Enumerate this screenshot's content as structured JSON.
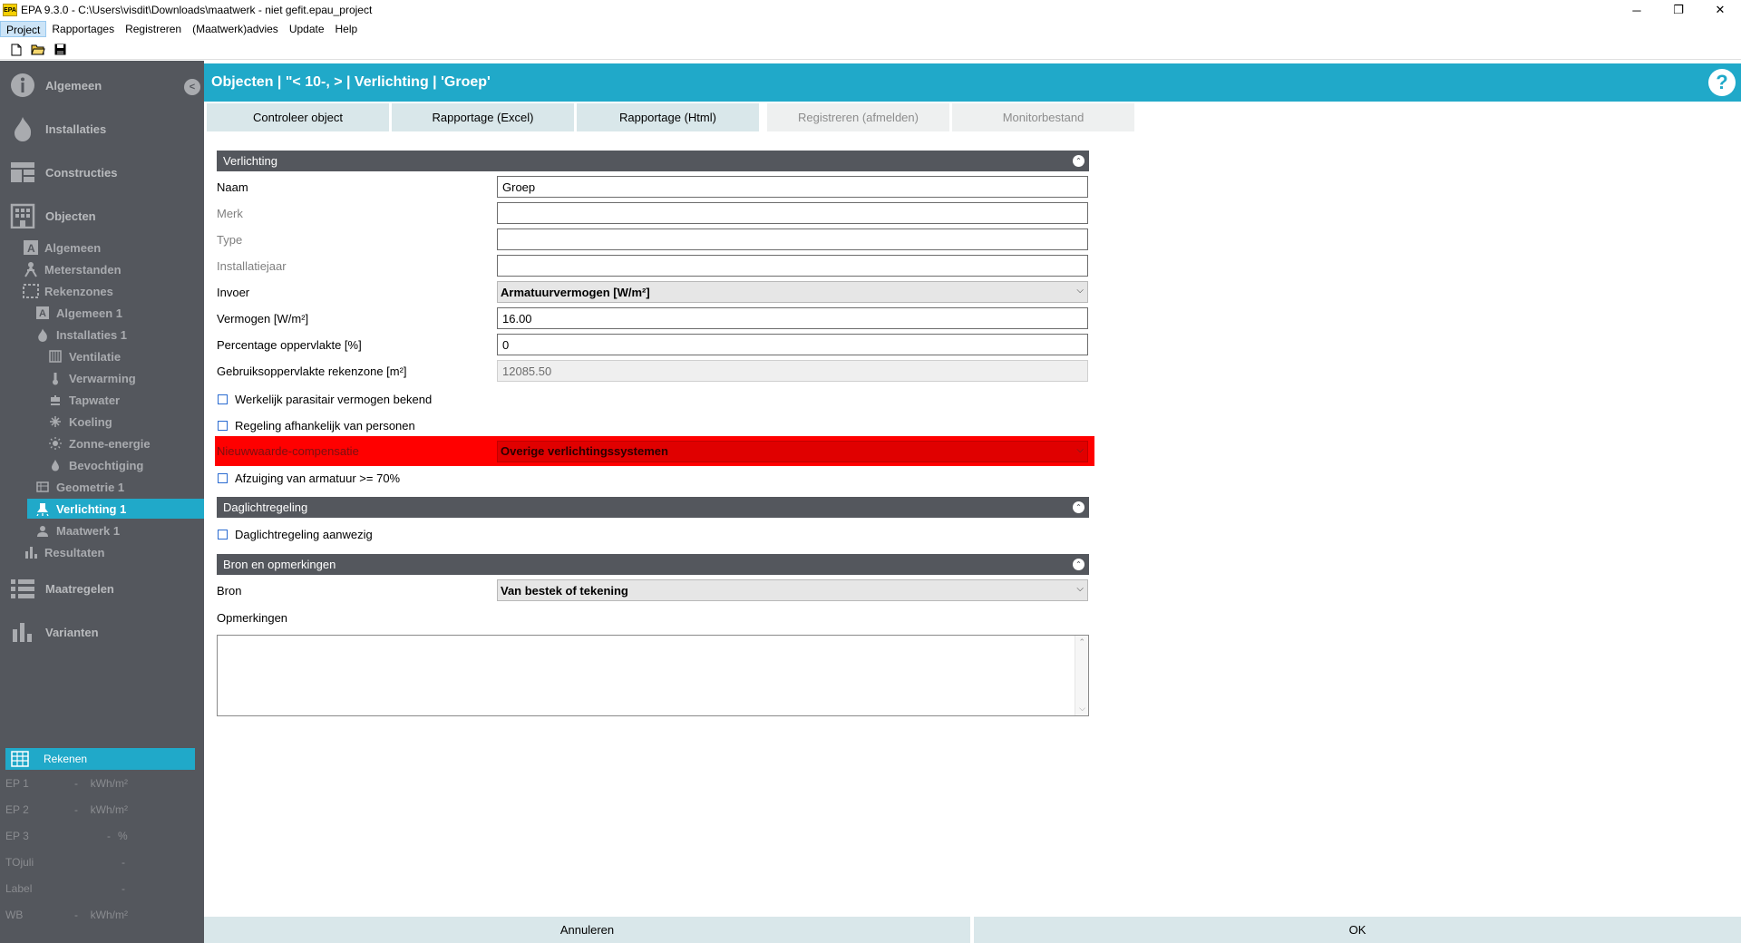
{
  "window": {
    "title": "EPA 9.3.0 - C:\\Users\\visdit\\Downloads\\maatwerk - niet gefit.epau_project",
    "app_icon_text": "EPA",
    "controls": {
      "minimize": "─",
      "restore": "❐",
      "close": "✕"
    }
  },
  "menu": [
    "Project",
    "Rapportages",
    "Registreren",
    "(Maatwerk)advies",
    "Update",
    "Help"
  ],
  "sidebar": {
    "top_items": [
      {
        "label": "Algemeen",
        "icon": "info-icon"
      },
      {
        "label": "Installaties",
        "icon": "flame-icon"
      },
      {
        "label": "Constructies",
        "icon": "wall-icon"
      },
      {
        "label": "Objecten",
        "icon": "building-icon"
      }
    ],
    "sub_items": [
      {
        "label": "Algemeen",
        "icon": "letter-a-icon"
      },
      {
        "label": "Meterstanden",
        "icon": "meter-icon"
      },
      {
        "label": "Rekenzones",
        "icon": "zones-icon"
      },
      {
        "label": "Algemeen 1",
        "icon": "letter-a-icon"
      },
      {
        "label": "Installaties 1",
        "icon": "flame-icon"
      },
      {
        "label": "Ventilatie",
        "icon": "ventilation-icon"
      },
      {
        "label": "Verwarming",
        "icon": "thermometer-icon"
      },
      {
        "label": "Tapwater",
        "icon": "tap-icon"
      },
      {
        "label": "Koeling",
        "icon": "snowflake-icon"
      },
      {
        "label": "Zonne-energie",
        "icon": "sun-icon"
      },
      {
        "label": "Bevochtiging",
        "icon": "droplet-icon"
      },
      {
        "label": "Geometrie 1",
        "icon": "geometry-icon"
      },
      {
        "label": "Verlichting 1",
        "icon": "lamp-icon"
      },
      {
        "label": "Maatwerk 1",
        "icon": "person-icon"
      },
      {
        "label": "Resultaten",
        "icon": "bar-chart-icon"
      }
    ],
    "bottom_items": [
      {
        "label": "Maatregelen",
        "icon": "list-icon"
      },
      {
        "label": "Varianten",
        "icon": "bar-chart-icon"
      }
    ],
    "rekenen": "Rekenen",
    "results": [
      {
        "label": "EP 1",
        "value": "-",
        "unit": "kWh/m²"
      },
      {
        "label": "EP 2",
        "value": "-",
        "unit": "kWh/m²"
      },
      {
        "label": "EP 3",
        "value": "-",
        "unit": "%"
      },
      {
        "label": "TOjuli",
        "value": "-",
        "unit": ""
      },
      {
        "label": "Label",
        "value": "-",
        "unit": ""
      },
      {
        "label": "WB",
        "value": "-",
        "unit": "kWh/m²"
      }
    ]
  },
  "header": {
    "title": "Objecten | \"< 10-,  > | Verlichting | 'Groep'",
    "help": "?"
  },
  "tabs": [
    {
      "label": "Controleer object",
      "enabled": true
    },
    {
      "label": "Rapportage (Excel)",
      "enabled": true
    },
    {
      "label": "Rapportage (Html)",
      "enabled": true
    },
    {
      "label": "Registreren (afmelden)",
      "enabled": false
    },
    {
      "label": "Monitorbestand",
      "enabled": false
    }
  ],
  "sections": {
    "verlichting": "Verlichting",
    "daglicht": "Daglichtregeling",
    "bron": "Bron en opmerkingen"
  },
  "form": {
    "naam": {
      "label": "Naam",
      "value": "Groep"
    },
    "merk": {
      "label": "Merk",
      "value": ""
    },
    "type": {
      "label": "Type",
      "value": ""
    },
    "jaar": {
      "label": "Installatiejaar",
      "value": ""
    },
    "invoer": {
      "label": "Invoer",
      "value": "Armatuurvermogen [W/m²]"
    },
    "vermogen": {
      "label": "Vermogen [W/m²]",
      "value": "16.00"
    },
    "percentage": {
      "label": "Percentage oppervlakte [%]",
      "value": "0"
    },
    "gebruiksopp": {
      "label": "Gebruiksoppervlakte rekenzone [m²]",
      "value": "12085.50"
    },
    "cb_parasitair": "Werkelijk parasitair vermogen bekend",
    "cb_regeling": "Regeling afhankelijk van personen",
    "nieuwwaarde": {
      "label": "Nieuwwaarde-compensatie",
      "value": "Overige verlichtingssystemen"
    },
    "cb_afzuiging": "Afzuiging van armatuur >= 70%",
    "cb_daglicht": "Daglichtregeling aanwezig",
    "bron": {
      "label": "Bron",
      "value": "Van bestek of tekening"
    },
    "opmerkingen": {
      "label": "Opmerkingen",
      "value": ""
    }
  },
  "footer": {
    "cancel": "Annuleren",
    "ok": "OK"
  },
  "colors": {
    "accent": "#20a9c9",
    "sidebar": "#54575d",
    "error": "#ff0000"
  }
}
